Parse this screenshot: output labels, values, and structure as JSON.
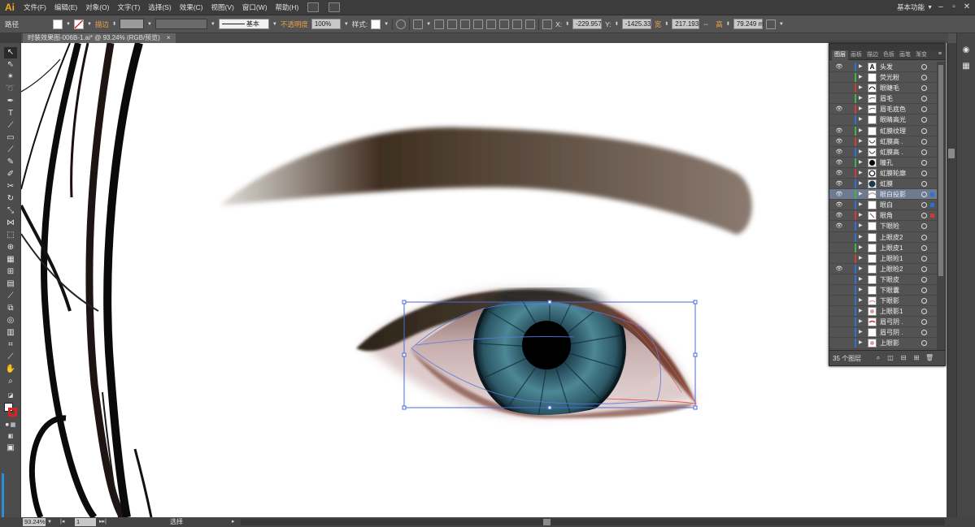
{
  "app": {
    "logo": "Ai",
    "workspace": "基本功能"
  },
  "menu": [
    "文件(F)",
    "编辑(E)",
    "对象(O)",
    "文字(T)",
    "选择(S)",
    "效果(C)",
    "视图(V)",
    "窗口(W)",
    "帮助(H)"
  ],
  "control_bar": {
    "path_label": "路径",
    "stroke_label": "描边",
    "stroke_style": "基本",
    "opacity_label": "不透明度",
    "opacity_value": "100%",
    "style_label": "样式:",
    "x_value": "-229.957",
    "y_value": "-1425.33",
    "width_label": "宽",
    "width_value": "217.193",
    "height_label": "高",
    "height_value": "79.249 m"
  },
  "document": {
    "tab_title": "时装效果图-006B-1.ai* @ 93.24% (RGB/预览)"
  },
  "status": {
    "zoom": "93.24%",
    "page": "1",
    "tool_text": "选择"
  },
  "layers_panel": {
    "tabs": [
      "图层",
      "画板",
      "描边",
      "色板",
      "画笔",
      "渐变"
    ],
    "count_label": "35 个图层",
    "layers": [
      {
        "name": "头发",
        "eye": true,
        "color": "#2e6fd8",
        "thumb": "text"
      },
      {
        "name": "荧光粉",
        "eye": false,
        "color": "#3fb24a",
        "thumb": "blank"
      },
      {
        "name": "眼睫毛",
        "eye": false,
        "color": "#d23a3a",
        "thumb": "lash"
      },
      {
        "name": "眉毛",
        "eye": false,
        "color": "#3fb24a",
        "thumb": "brow"
      },
      {
        "name": "眉毛底色",
        "eye": true,
        "color": "#d23a3a",
        "thumb": "brow"
      },
      {
        "name": "眼睛高光",
        "eye": false,
        "color": "#2e6fd8",
        "thumb": "blank"
      },
      {
        "name": "虹膜纹理",
        "eye": true,
        "color": "#3fb24a",
        "thumb": "blank"
      },
      {
        "name": "虹膜高 .",
        "eye": true,
        "color": "#d23a3a",
        "thumb": "arc"
      },
      {
        "name": "虹膜高 .",
        "eye": true,
        "color": "#2e6fd8",
        "thumb": "arc"
      },
      {
        "name": "瞳孔",
        "eye": true,
        "color": "#3fb24a",
        "thumb": "dot"
      },
      {
        "name": "虹膜轮廓",
        "eye": true,
        "color": "#d23a3a",
        "thumb": "ring"
      },
      {
        "name": "虹膜",
        "eye": true,
        "color": "#2e6fd8",
        "thumb": "iris"
      },
      {
        "name": "眼白投影",
        "eye": true,
        "color": "#3fb24a",
        "thumb": "shadow",
        "selected": true,
        "sel_color": "#2e6fd8"
      },
      {
        "name": "眼白",
        "eye": true,
        "color": "#2e6fd8",
        "thumb": "blank",
        "sel_color": "#2e6fd8"
      },
      {
        "name": "眼角",
        "eye": true,
        "color": "#d23a3a",
        "thumb": "corner",
        "sel_color": "#d23a3a"
      },
      {
        "name": "下眼睑",
        "eye": true,
        "color": "#2e6fd8",
        "thumb": "blank"
      },
      {
        "name": "上眼皮2",
        "eye": false,
        "color": "#2e6fd8",
        "thumb": "blank"
      },
      {
        "name": "上眼皮1",
        "eye": false,
        "color": "#3fb24a",
        "thumb": "blank"
      },
      {
        "name": "上眼睑1",
        "eye": false,
        "color": "#d23a3a",
        "thumb": "blank"
      },
      {
        "name": "上眼睑2",
        "eye": true,
        "color": "#2e6fd8",
        "thumb": "blank"
      },
      {
        "name": "下眼皮",
        "eye": false,
        "color": "#2e6fd8",
        "thumb": "blank"
      },
      {
        "name": "下眼囊",
        "eye": false,
        "color": "#2e6fd8",
        "thumb": "blank"
      },
      {
        "name": "下眼影",
        "eye": false,
        "color": "#2e6fd8",
        "thumb": "pink"
      },
      {
        "name": "上眼影1",
        "eye": false,
        "color": "#2e6fd8",
        "thumb": "pinkdot"
      },
      {
        "name": "眉弓阴 .",
        "eye": false,
        "color": "#2e6fd8",
        "thumb": "redline"
      },
      {
        "name": "眉弓阴 .",
        "eye": false,
        "color": "#2e6fd8",
        "thumb": "blank"
      },
      {
        "name": "上眼影",
        "eye": false,
        "color": "#2e6fd8",
        "thumb": "pinkdot"
      }
    ]
  }
}
